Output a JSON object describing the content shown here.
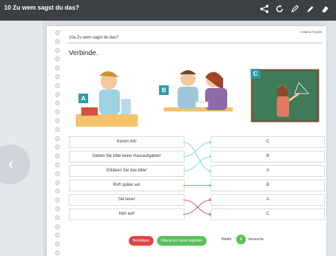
{
  "window": {
    "title": "10 Zu wem sagst du das?"
  },
  "toolbar": {
    "icons": [
      "share-icon",
      "refresh-icon",
      "pencil-icon",
      "marker-icon",
      "eraser-icon"
    ]
  },
  "page": {
    "header_left": "10a Zu wem sagst du das?",
    "header_right": "6 Meine Familie",
    "instruction": "Verbinde."
  },
  "images": [
    {
      "label": "A"
    },
    {
      "label": "B"
    },
    {
      "label": "C"
    }
  ],
  "phrases": [
    "Komm mit!",
    "Geben Sie bitte keine Hausaufgaben!",
    "Erklären Sie das bitte!",
    "Ruft später an!",
    "Sei leise!",
    "Hört auf!"
  ],
  "answers": [
    "C",
    "B",
    "A",
    "B",
    "A",
    "C"
  ],
  "connections": [
    {
      "from": 0,
      "to": 2,
      "color": "#7fd3d8"
    },
    {
      "from": 1,
      "to": 0,
      "color": "#7fd3d8"
    },
    {
      "from": 2,
      "to": 1,
      "color": "#7fd3d8"
    },
    {
      "from": 3,
      "to": 3,
      "color": "#5cc05c"
    },
    {
      "from": 4,
      "to": 5,
      "color": "#e05050"
    },
    {
      "from": 5,
      "to": 4,
      "color": "#e05050"
    }
  ],
  "footer": {
    "confirm_label": "Bestätigen",
    "restart_label": "Übung von vorne beginnen",
    "remaining_label": "Bleibt",
    "remaining_count": "1",
    "attempts_label": "Versuche"
  },
  "colors": {
    "label_bg": "#2f9aa8",
    "confirm": "#e04444",
    "restart": "#5cc05c"
  }
}
